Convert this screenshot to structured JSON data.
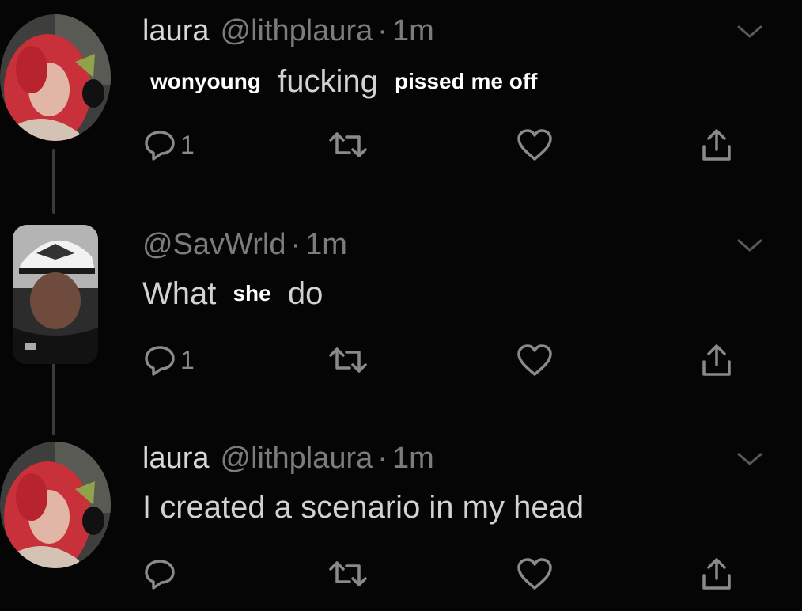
{
  "tweets": [
    {
      "name": "laura",
      "handle": "@lithplaura",
      "separator": "·",
      "time": "1m",
      "text_parts": [
        "wonyoung",
        "fucking",
        "pissed me off"
      ],
      "reply_count": "1",
      "avatar": "red-hair-avatar"
    },
    {
      "name": "",
      "handle": "@SavWrld",
      "separator": "·",
      "time": "1m",
      "text_parts": [
        "What",
        "she",
        "do"
      ],
      "reply_count": "1",
      "avatar": "cap-wearing-avatar"
    },
    {
      "name": "laura",
      "handle": "@lithplaura",
      "separator": "·",
      "time": "1m",
      "text": "I created a scenario in my head",
      "reply_count": "",
      "avatar": "red-hair-avatar"
    }
  ],
  "icons": {
    "reply": "reply-icon",
    "retweet": "retweet-icon",
    "like": "heart-icon",
    "share": "share-icon",
    "more": "chevron-down-icon"
  },
  "colors": {
    "background": "#050505",
    "icon": "#8a8a8a",
    "name": "#d8d8d8",
    "muted": "#7c7c7c",
    "thread_line": "#3a3a3a"
  }
}
